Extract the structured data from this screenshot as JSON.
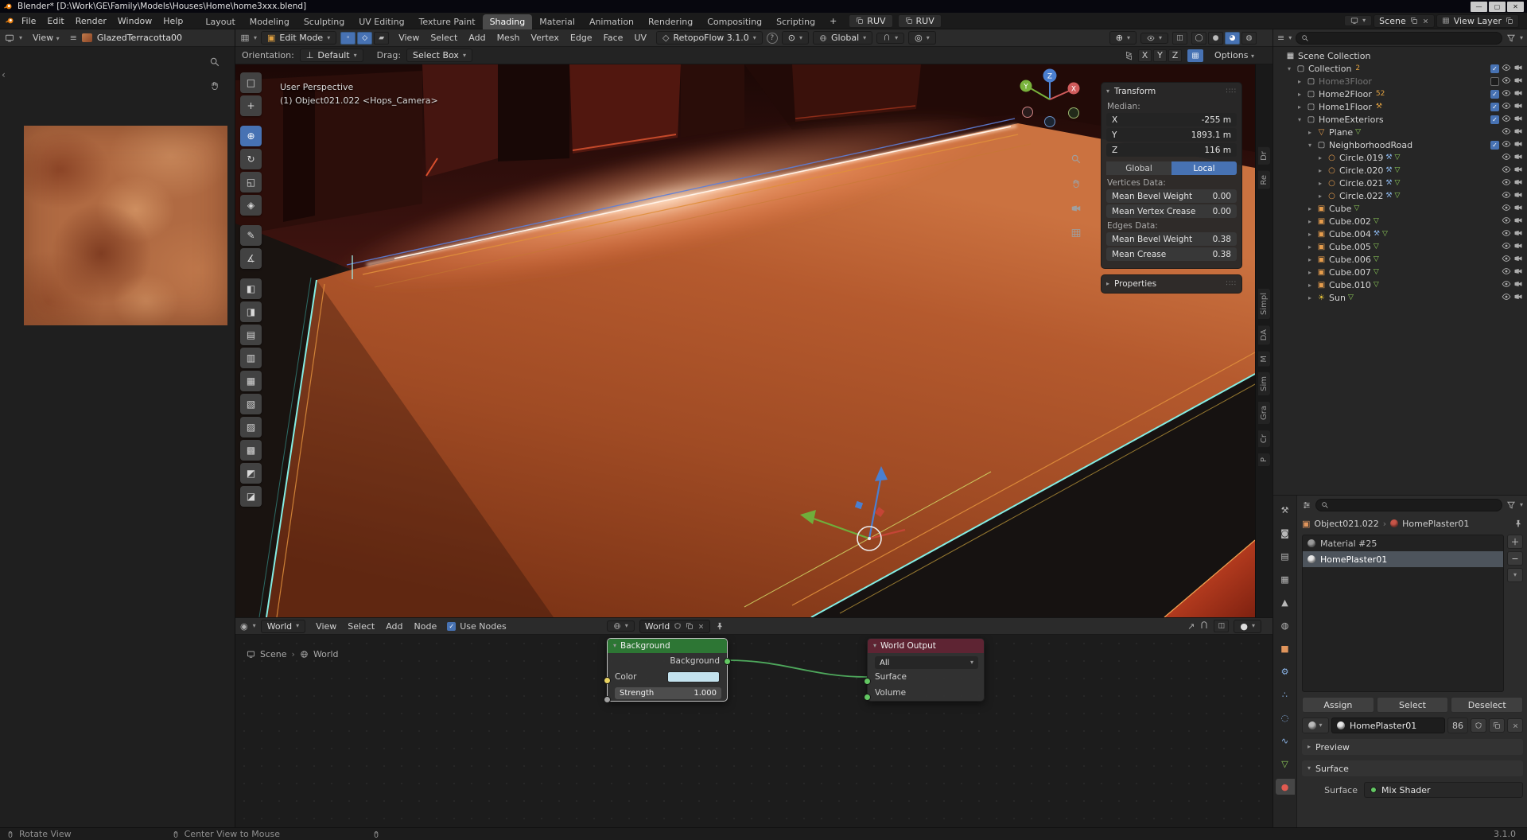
{
  "icons": {
    "scenecoll": {
      "glyph": "▦",
      "color": "#DDDDDD"
    },
    "coll": {
      "glyph": "▢",
      "color": "#C9C9C9"
    },
    "mesh": {
      "glyph": "▽",
      "color": "#E59C4C"
    },
    "circle": {
      "glyph": "○",
      "color": "#E59C4C"
    },
    "cube": {
      "glyph": "▣",
      "color": "#E59C4C"
    },
    "sun": {
      "glyph": "☀",
      "color": "#E5C23C"
    }
  },
  "titlebar": {
    "title": "Blender* [D:\\Work\\GE\\Family\\Models\\Houses\\Home\\home3xxx.blend]",
    "minimize": "—",
    "maximize": "▢",
    "close": "✕"
  },
  "topbar": {
    "menus": [
      "File",
      "Edit",
      "Render",
      "Window",
      "Help"
    ],
    "workspaces": [
      {
        "label": "Layout"
      },
      {
        "label": "Modeling"
      },
      {
        "label": "Sculpting"
      },
      {
        "label": "UV Editing"
      },
      {
        "label": "Texture Paint"
      },
      {
        "label": "Shading",
        "active": true
      },
      {
        "label": "Material"
      },
      {
        "label": "Animation"
      },
      {
        "label": "Rendering"
      },
      {
        "label": "Compositing"
      },
      {
        "label": "Scripting"
      }
    ],
    "add_workspace": "+",
    "ruv_buttons": [
      {
        "label": "RUV"
      },
      {
        "label": "RUV"
      }
    ],
    "scene": "Scene",
    "view_layer": "View Layer"
  },
  "viewport_header": {
    "mode": "Edit Mode",
    "select_modes": [
      {
        "glyph": "◦",
        "active": true
      },
      {
        "glyph": "◇",
        "active": true
      },
      {
        "glyph": "▰"
      }
    ],
    "menus": [
      "View",
      "Select",
      "Add",
      "Mesh",
      "Vertex",
      "Edge",
      "Face",
      "UV"
    ],
    "retopoflow": "RetopoFlow 3.1.0",
    "orientation": "Global",
    "shading_modes": [
      {
        "glyph": "◯"
      },
      {
        "glyph": "●"
      },
      {
        "glyph": "◕",
        "active": true
      },
      {
        "glyph": "◍"
      }
    ]
  },
  "tool_settings": {
    "orientation_label": "Orientation:",
    "orientation_value": "Default",
    "drag_label": "Drag:",
    "drag_value": "Select Box",
    "axes": [
      {
        "label": "X"
      },
      {
        "label": "Y"
      },
      {
        "label": "Z"
      }
    ],
    "options": "Options"
  },
  "image_editor": {
    "view_menu": "View",
    "image_name": "GlazedTerracotta00"
  },
  "toolbar": {
    "tools": [
      {
        "glyph": "□",
        "tool": "select-box"
      },
      {
        "glyph": "+",
        "tool": "cursor"
      },
      {
        "glyph": "⊕",
        "tool": "move",
        "active": true,
        "gap": true
      },
      {
        "glyph": "↻",
        "tool": "rotate"
      },
      {
        "glyph": "◱",
        "tool": "scale"
      },
      {
        "glyph": "◈",
        "tool": "transform"
      },
      {
        "glyph": "✎",
        "tool": "annotate",
        "gap": true
      },
      {
        "glyph": "∡",
        "tool": "measure"
      },
      {
        "glyph": "◧",
        "gap": true
      },
      {
        "glyph": "◨"
      },
      {
        "glyph": "▤"
      },
      {
        "glyph": "▥"
      },
      {
        "glyph": "▦"
      },
      {
        "glyph": "▧"
      },
      {
        "glyph": "▨"
      },
      {
        "glyph": "▩"
      },
      {
        "glyph": "◩"
      },
      {
        "glyph": "◪"
      }
    ]
  },
  "viewport": {
    "perspective": "User Perspective",
    "object_info": "(1) Object021.022 <Hops_Camera>"
  },
  "npanel": {
    "tabs": [
      {
        "label": "Dr"
      },
      {
        "label": "Re"
      },
      {
        "label": "Simpl",
        "gap": true
      },
      {
        "label": "DA"
      },
      {
        "label": "M"
      },
      {
        "label": "Sim"
      },
      {
        "label": "Gra"
      },
      {
        "label": "Cr"
      },
      {
        "label": "P"
      }
    ],
    "transform": {
      "title": "Transform",
      "median_label": "Median:",
      "axis_fields": [
        {
          "axis": "X",
          "value": "-255 m"
        },
        {
          "axis": "Y",
          "value": "1893.1 m"
        },
        {
          "axis": "Z",
          "value": "116 m"
        }
      ],
      "space_buttons": [
        {
          "label": "Global"
        },
        {
          "label": "Local",
          "active": true
        }
      ],
      "vertices_label": "Vertices Data:",
      "vertex_rows": [
        {
          "label": "Mean Bevel Weight",
          "value": "0.00"
        },
        {
          "label": "Mean Vertex Crease",
          "value": "0.00"
        }
      ],
      "edges_label": "Edges Data:",
      "edge_rows": [
        {
          "label": "Mean Bevel Weight",
          "value": "0.38"
        },
        {
          "label": "Mean Crease",
          "value": "0.38"
        }
      ]
    },
    "properties_title": "Properties"
  },
  "outliner": {
    "items": [
      {
        "label": "Scene Collection",
        "depth": 0,
        "icon": "scenecoll"
      },
      {
        "label": "Collection",
        "depth": 1,
        "arrow": "▾",
        "icon": "coll",
        "has_check": true,
        "checked": true,
        "badge": "2",
        "vis": true
      },
      {
        "label": "Home3Floor",
        "depth": 2,
        "arrow": "▸",
        "icon": "coll",
        "has_check": true,
        "dim": true,
        "vis": true
      },
      {
        "label": "Home2Floor",
        "depth": 2,
        "arrow": "▸",
        "icon": "coll",
        "has_check": true,
        "checked": true,
        "badge": "52",
        "vis": true
      },
      {
        "label": "Home1Floor",
        "depth": 2,
        "arrow": "▸",
        "icon": "coll",
        "has_check": true,
        "checked": true,
        "badge": "⚒",
        "vis": true
      },
      {
        "label": "HomeExteriors",
        "depth": 2,
        "arrow": "▾",
        "icon": "coll",
        "has_check": true,
        "checked": true,
        "vis": true
      },
      {
        "label": "Plane",
        "depth": 3,
        "arrow": "▸",
        "icon": "mesh",
        "data": true,
        "vis": true
      },
      {
        "label": "NeighborhoodRoad",
        "depth": 3,
        "arrow": "▾",
        "icon": "coll",
        "has_check": true,
        "checked": true,
        "vis": true
      },
      {
        "label": "Circle.019",
        "depth": 4,
        "arrow": "▸",
        "icon": "circle",
        "mods": true,
        "data": true,
        "vis": true
      },
      {
        "label": "Circle.020",
        "depth": 4,
        "arrow": "▸",
        "icon": "circle",
        "mods": true,
        "data": true,
        "vis": true
      },
      {
        "label": "Circle.021",
        "depth": 4,
        "arrow": "▸",
        "icon": "circle",
        "mods": true,
        "data": true,
        "vis": true
      },
      {
        "label": "Circle.022",
        "depth": 4,
        "arrow": "▸",
        "icon": "circle",
        "mods": true,
        "data": true,
        "vis": true
      },
      {
        "label": "Cube",
        "depth": 3,
        "arrow": "▸",
        "icon": "cube",
        "data": true,
        "vis": true
      },
      {
        "label": "Cube.002",
        "depth": 3,
        "arrow": "▸",
        "icon": "cube",
        "data": true,
        "vis": true
      },
      {
        "label": "Cube.004",
        "depth": 3,
        "arrow": "▸",
        "icon": "cube",
        "mods": true,
        "data": true,
        "vis": true
      },
      {
        "label": "Cube.005",
        "depth": 3,
        "arrow": "▸",
        "icon": "cube",
        "data": true,
        "vis": true
      },
      {
        "label": "Cube.006",
        "depth": 3,
        "arrow": "▸",
        "icon": "cube",
        "data": true,
        "vis": true
      },
      {
        "label": "Cube.007",
        "depth": 3,
        "arrow": "▸",
        "icon": "cube",
        "data": true,
        "vis": true
      },
      {
        "label": "Cube.010",
        "depth": 3,
        "arrow": "▸",
        "icon": "cube",
        "data": true,
        "vis": true
      },
      {
        "label": "Sun",
        "depth": 3,
        "arrow": "▸",
        "icon": "sun",
        "data": true,
        "vis": true
      }
    ]
  },
  "properties": {
    "tabs": [
      {
        "name": "tool",
        "glyph": "⚒",
        "color": "#B8B8B8"
      },
      {
        "name": "render",
        "glyph": "◙",
        "color": "#B8B8B8"
      },
      {
        "name": "output",
        "glyph": "▤",
        "color": "#B8B8B8"
      },
      {
        "name": "view-layer",
        "glyph": "▦",
        "color": "#B8B8B8"
      },
      {
        "name": "scene",
        "glyph": "▲",
        "color": "#B8B8B8"
      },
      {
        "name": "world",
        "glyph": "◍",
        "color": "#B8B8B8"
      },
      {
        "name": "object",
        "glyph": "■",
        "color": "#E0955C"
      },
      {
        "name": "modifiers",
        "glyph": "⚙",
        "color": "#8AB4E8"
      },
      {
        "name": "particles",
        "glyph": "∴",
        "color": "#8AB4E8"
      },
      {
        "name": "physics",
        "glyph": "◌",
        "color": "#8AB4E8"
      },
      {
        "name": "constraints",
        "glyph": "∿",
        "color": "#8AB4E8"
      },
      {
        "name": "data",
        "glyph": "▽",
        "color": "#8FCE5A"
      },
      {
        "name": "material",
        "glyph": "●",
        "color": "#E05A50",
        "active": true
      }
    ],
    "breadcrumb_object": "Object021.022",
    "breadcrumb_material": "HomePlaster01",
    "slots": [
      {
        "label": "Material #25",
        "sphere": "#9A9A9A"
      },
      {
        "label": "HomePlaster01",
        "active": true,
        "sphere": "#E8E8E8"
      }
    ],
    "action_buttons": [
      {
        "label": "Assign"
      },
      {
        "label": "Select"
      },
      {
        "label": "Deselect"
      }
    ],
    "material_name": "HomePlaster01",
    "users_count": "86",
    "preview_title": "Preview",
    "surface_title": "Surface",
    "surface_label": "Surface",
    "surface_value": "Mix Shader"
  },
  "shader": {
    "type": "World",
    "menus": [
      "View",
      "Select",
      "Add",
      "Node"
    ],
    "use_nodes": "Use Nodes",
    "world_name": "World",
    "breadcrumb_scene": "Scene",
    "breadcrumb_world": "World",
    "background_node": {
      "title": "Background",
      "output_label": "Background",
      "color_label": "Color",
      "color_value": "#C3E2EE",
      "strength_label": "Strength",
      "strength_value": "1.000"
    },
    "output_node": {
      "title": "World Output",
      "target": "All",
      "surface_label": "Surface",
      "volume_label": "Volume"
    }
  },
  "statusbar": {
    "left": "Rotate View",
    "middle": "Center View to Mouse",
    "version": "3.1.0"
  },
  "colors": {
    "accent": "#4772B3",
    "selection_edge": "#84EEE4",
    "wire_orange": "#E08F3C",
    "node_wire": "#4EA85C",
    "background_node_header": "#2D7634",
    "output_node_header": "#5E2433"
  }
}
